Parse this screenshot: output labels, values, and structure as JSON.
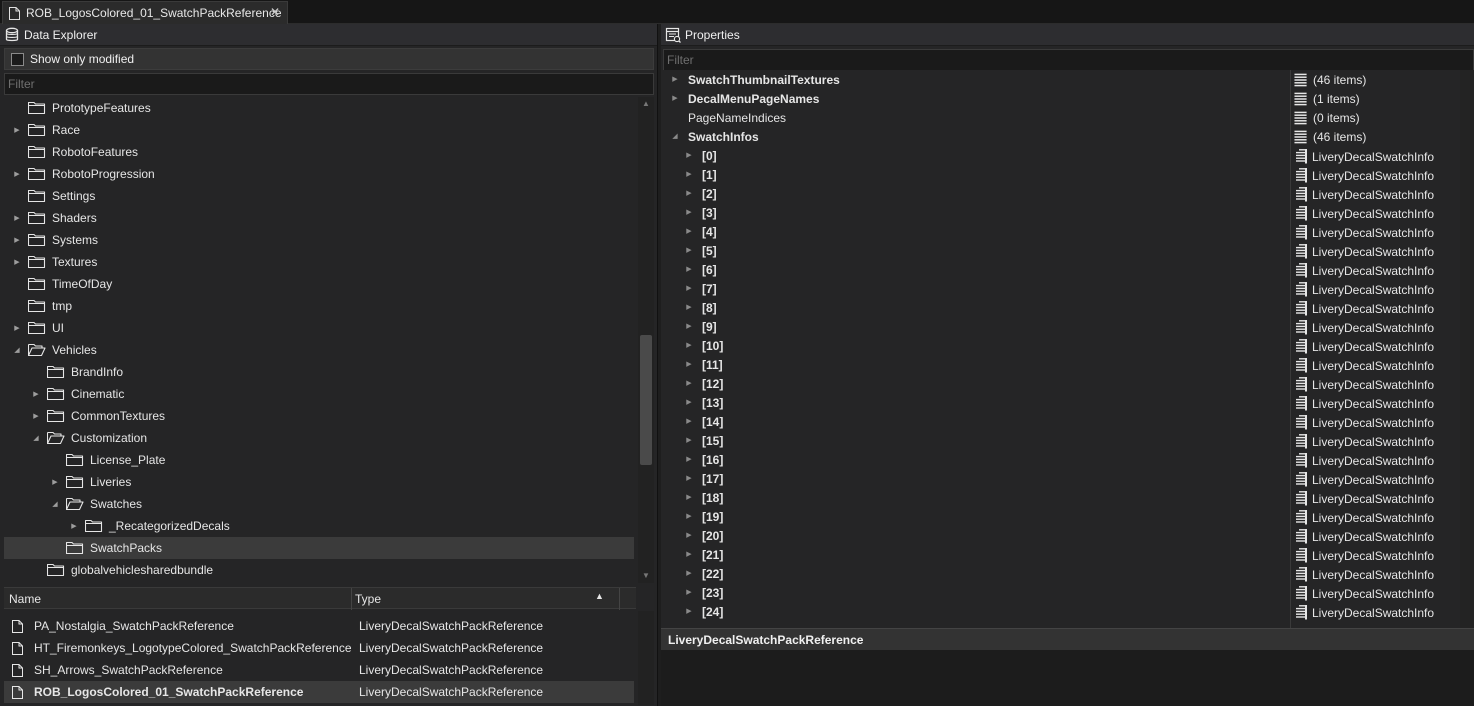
{
  "document_tab": {
    "title": "ROB_LogosColored_01_SwatchPackReference",
    "close": "✕"
  },
  "data_explorer": {
    "title": "Data Explorer",
    "show_only_modified": "Show only modified",
    "filter_placeholder": "Filter",
    "tree": [
      {
        "label": "PrototypeFeatures",
        "depth": 0,
        "expander": "none",
        "open": false
      },
      {
        "label": "Race",
        "depth": 0,
        "expander": "collapsed",
        "open": false
      },
      {
        "label": "RobotoFeatures",
        "depth": 0,
        "expander": "none",
        "open": false
      },
      {
        "label": "RobotoProgression",
        "depth": 0,
        "expander": "collapsed",
        "open": false
      },
      {
        "label": "Settings",
        "depth": 0,
        "expander": "none",
        "open": false
      },
      {
        "label": "Shaders",
        "depth": 0,
        "expander": "collapsed",
        "open": false
      },
      {
        "label": "Systems",
        "depth": 0,
        "expander": "collapsed",
        "open": false
      },
      {
        "label": "Textures",
        "depth": 0,
        "expander": "collapsed",
        "open": false
      },
      {
        "label": "TimeOfDay",
        "depth": 0,
        "expander": "none",
        "open": false
      },
      {
        "label": "tmp",
        "depth": 0,
        "expander": "none",
        "open": false
      },
      {
        "label": "UI",
        "depth": 0,
        "expander": "collapsed",
        "open": false
      },
      {
        "label": "Vehicles",
        "depth": 0,
        "expander": "expanded",
        "open": true
      },
      {
        "label": "BrandInfo",
        "depth": 1,
        "expander": "none",
        "open": false
      },
      {
        "label": "Cinematic",
        "depth": 1,
        "expander": "collapsed",
        "open": false
      },
      {
        "label": "CommonTextures",
        "depth": 1,
        "expander": "collapsed",
        "open": false
      },
      {
        "label": "Customization",
        "depth": 1,
        "expander": "expanded",
        "open": true
      },
      {
        "label": "License_Plate",
        "depth": 2,
        "expander": "none",
        "open": false
      },
      {
        "label": "Liveries",
        "depth": 2,
        "expander": "collapsed",
        "open": false
      },
      {
        "label": "Swatches",
        "depth": 2,
        "expander": "expanded",
        "open": true
      },
      {
        "label": "_RecategorizedDecals",
        "depth": 3,
        "expander": "collapsed",
        "open": false
      },
      {
        "label": "SwatchPacks",
        "depth": 2,
        "expander": "none",
        "open": false,
        "selected": true
      },
      {
        "label": "globalvehiclesharedbundle",
        "depth": 1,
        "expander": "none",
        "open": false
      }
    ],
    "list_columns": {
      "name": "Name",
      "type": "Type"
    },
    "list_rows": [
      {
        "name": "PA_Nostalgia_SwatchPackReference",
        "type": "LiveryDecalSwatchPackReference"
      },
      {
        "name": "HT_Firemonkeys_LogotypeColored_SwatchPackReference",
        "type": "LiveryDecalSwatchPackReference"
      },
      {
        "name": "SH_Arrows_SwatchPackReference",
        "type": "LiveryDecalSwatchPackReference"
      },
      {
        "name": "ROB_LogosColored_01_SwatchPackReference",
        "type": "LiveryDecalSwatchPackReference",
        "selected": true
      }
    ]
  },
  "properties": {
    "title": "Properties",
    "filter_placeholder": "Filter",
    "rows": [
      {
        "name": "SwatchThumbnailTextures",
        "value": "(46 items)",
        "bold": true,
        "expander": "collapsed",
        "indent": 0,
        "icon": "list"
      },
      {
        "name": "DecalMenuPageNames",
        "value": "(1 items)",
        "bold": true,
        "expander": "collapsed",
        "indent": 0,
        "icon": "list"
      },
      {
        "name": "PageNameIndices",
        "value": "(0 items)",
        "bold": false,
        "expander": "none",
        "indent": 0,
        "icon": "list"
      },
      {
        "name": "SwatchInfos",
        "value": "(46 items)",
        "bold": true,
        "expander": "expanded",
        "indent": 0,
        "icon": "list"
      },
      {
        "name": "[0]",
        "value": "LiveryDecalSwatchInfo",
        "bold": true,
        "expander": "collapsed",
        "indent": 1,
        "icon": "object"
      },
      {
        "name": "[1]",
        "value": "LiveryDecalSwatchInfo",
        "bold": true,
        "expander": "collapsed",
        "indent": 1,
        "icon": "object"
      },
      {
        "name": "[2]",
        "value": "LiveryDecalSwatchInfo",
        "bold": true,
        "expander": "collapsed",
        "indent": 1,
        "icon": "object"
      },
      {
        "name": "[3]",
        "value": "LiveryDecalSwatchInfo",
        "bold": true,
        "expander": "collapsed",
        "indent": 1,
        "icon": "object"
      },
      {
        "name": "[4]",
        "value": "LiveryDecalSwatchInfo",
        "bold": true,
        "expander": "collapsed",
        "indent": 1,
        "icon": "object"
      },
      {
        "name": "[5]",
        "value": "LiveryDecalSwatchInfo",
        "bold": true,
        "expander": "collapsed",
        "indent": 1,
        "icon": "object"
      },
      {
        "name": "[6]",
        "value": "LiveryDecalSwatchInfo",
        "bold": true,
        "expander": "collapsed",
        "indent": 1,
        "icon": "object"
      },
      {
        "name": "[7]",
        "value": "LiveryDecalSwatchInfo",
        "bold": true,
        "expander": "collapsed",
        "indent": 1,
        "icon": "object"
      },
      {
        "name": "[8]",
        "value": "LiveryDecalSwatchInfo",
        "bold": true,
        "expander": "collapsed",
        "indent": 1,
        "icon": "object"
      },
      {
        "name": "[9]",
        "value": "LiveryDecalSwatchInfo",
        "bold": true,
        "expander": "collapsed",
        "indent": 1,
        "icon": "object"
      },
      {
        "name": "[10]",
        "value": "LiveryDecalSwatchInfo",
        "bold": true,
        "expander": "collapsed",
        "indent": 1,
        "icon": "object"
      },
      {
        "name": "[11]",
        "value": "LiveryDecalSwatchInfo",
        "bold": true,
        "expander": "collapsed",
        "indent": 1,
        "icon": "object"
      },
      {
        "name": "[12]",
        "value": "LiveryDecalSwatchInfo",
        "bold": true,
        "expander": "collapsed",
        "indent": 1,
        "icon": "object"
      },
      {
        "name": "[13]",
        "value": "LiveryDecalSwatchInfo",
        "bold": true,
        "expander": "collapsed",
        "indent": 1,
        "icon": "object"
      },
      {
        "name": "[14]",
        "value": "LiveryDecalSwatchInfo",
        "bold": true,
        "expander": "collapsed",
        "indent": 1,
        "icon": "object"
      },
      {
        "name": "[15]",
        "value": "LiveryDecalSwatchInfo",
        "bold": true,
        "expander": "collapsed",
        "indent": 1,
        "icon": "object"
      },
      {
        "name": "[16]",
        "value": "LiveryDecalSwatchInfo",
        "bold": true,
        "expander": "collapsed",
        "indent": 1,
        "icon": "object"
      },
      {
        "name": "[17]",
        "value": "LiveryDecalSwatchInfo",
        "bold": true,
        "expander": "collapsed",
        "indent": 1,
        "icon": "object"
      },
      {
        "name": "[18]",
        "value": "LiveryDecalSwatchInfo",
        "bold": true,
        "expander": "collapsed",
        "indent": 1,
        "icon": "object"
      },
      {
        "name": "[19]",
        "value": "LiveryDecalSwatchInfo",
        "bold": true,
        "expander": "collapsed",
        "indent": 1,
        "icon": "object"
      },
      {
        "name": "[20]",
        "value": "LiveryDecalSwatchInfo",
        "bold": true,
        "expander": "collapsed",
        "indent": 1,
        "icon": "object"
      },
      {
        "name": "[21]",
        "value": "LiveryDecalSwatchInfo",
        "bold": true,
        "expander": "collapsed",
        "indent": 1,
        "icon": "object"
      },
      {
        "name": "[22]",
        "value": "LiveryDecalSwatchInfo",
        "bold": true,
        "expander": "collapsed",
        "indent": 1,
        "icon": "object"
      },
      {
        "name": "[23]",
        "value": "LiveryDecalSwatchInfo",
        "bold": true,
        "expander": "collapsed",
        "indent": 1,
        "icon": "object"
      },
      {
        "name": "[24]",
        "value": "LiveryDecalSwatchInfo",
        "bold": true,
        "expander": "collapsed",
        "indent": 1,
        "icon": "object"
      }
    ],
    "description": "LiveryDecalSwatchPackReference"
  },
  "icons": {
    "expander_collapsed": "▶",
    "expander_expanded": "◢",
    "sort_ascending": "▲",
    "scroll_up": "▲",
    "scroll_down": "▼"
  }
}
